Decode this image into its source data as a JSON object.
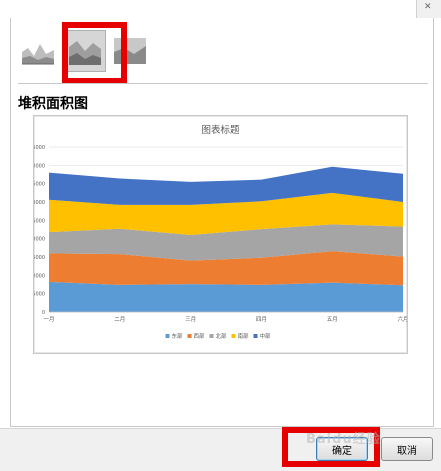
{
  "section": {
    "chart_type_label": "堆积面积图"
  },
  "icons": [
    {
      "name": "area-chart-icon",
      "selected": false
    },
    {
      "name": "stacked-area-chart-icon",
      "selected": true
    },
    {
      "name": "percent-stacked-area-chart-icon",
      "selected": false
    }
  ],
  "buttons": {
    "ok_label": "确定",
    "cancel_label": "取消"
  },
  "watermark": "Baidu经验",
  "colors": {
    "highlight_box": "#e60000",
    "series_1": "#5b9bd5",
    "series_2": "#ed7d31",
    "series_3": "#a5a5a5",
    "series_4": "#ffc000",
    "series_5": "#4472c4"
  },
  "chart_data": {
    "type": "area",
    "stacked": true,
    "title": "图表标题",
    "categories": [
      "一月",
      "二月",
      "三月",
      "四月",
      "五月",
      "六月"
    ],
    "ylim": [
      0,
      45000
    ],
    "yticks": [
      0,
      5000,
      10000,
      15000,
      20000,
      25000,
      30000,
      35000,
      40000,
      45000
    ],
    "grid": true,
    "legend_position": "bottom",
    "series": [
      {
        "name": "东部",
        "color": "#5b9bd5",
        "values": [
          8200,
          7400,
          7600,
          7400,
          8000,
          7300
        ]
      },
      {
        "name": "西部",
        "color": "#ed7d31",
        "values": [
          7800,
          8400,
          6400,
          7400,
          8600,
          7800
        ]
      },
      {
        "name": "北部",
        "color": "#a5a5a5",
        "values": [
          5800,
          6900,
          7000,
          7800,
          7300,
          8200
        ]
      },
      {
        "name": "南部",
        "color": "#ffc000",
        "values": [
          8800,
          6500,
          8200,
          7600,
          8600,
          6700
        ]
      },
      {
        "name": "中部",
        "color": "#4472c4",
        "values": [
          7400,
          7200,
          6300,
          5900,
          7100,
          7700
        ]
      }
    ]
  }
}
